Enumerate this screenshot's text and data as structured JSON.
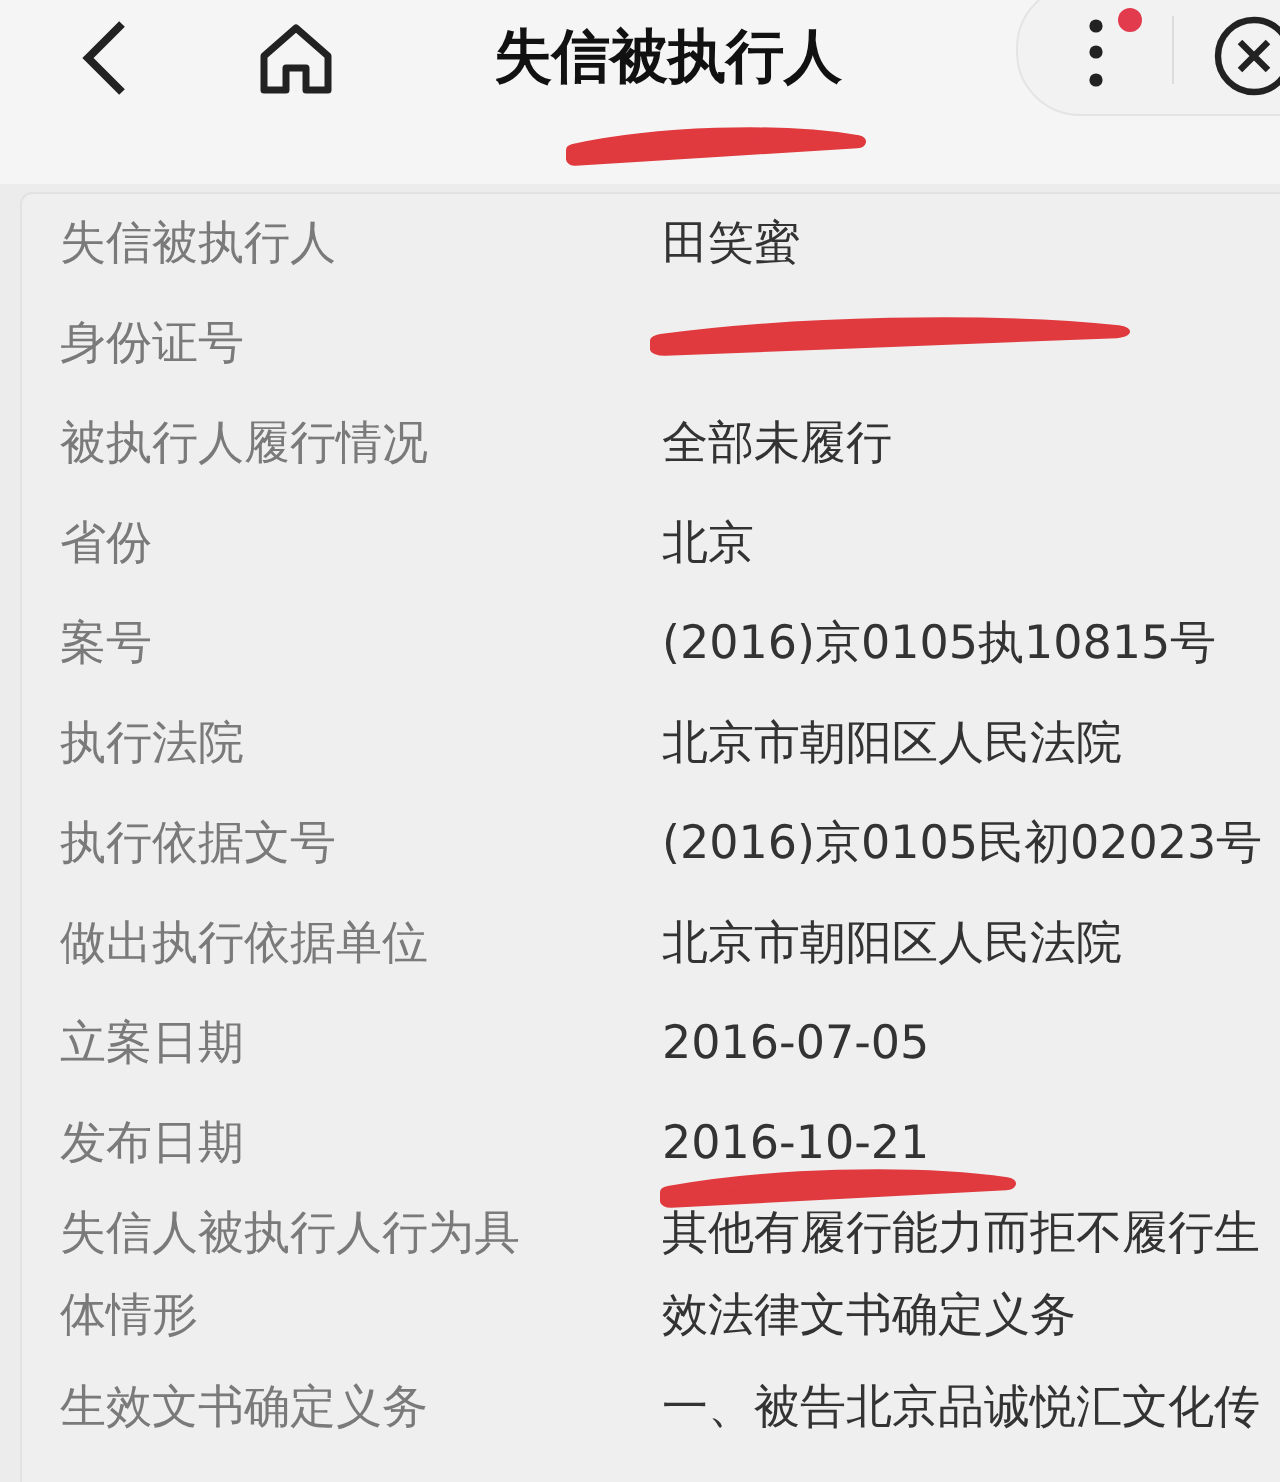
{
  "top_bar": {
    "title": "失信被执行人",
    "title_redacted": true,
    "menu_badge": true
  },
  "rows": [
    {
      "label": [
        "失信被执行人"
      ],
      "value": [
        "田笑蜜"
      ],
      "redacted": false
    },
    {
      "label": [
        "身份证号"
      ],
      "value": [],
      "redacted": true
    },
    {
      "label": [
        "被执行人履行情况"
      ],
      "value": [
        "全部未履行"
      ],
      "redacted": false
    },
    {
      "label": [
        "省份"
      ],
      "value": [
        "北京"
      ],
      "redacted": false
    },
    {
      "label": [
        "案号"
      ],
      "value": [
        "(2016)京0105执10815号"
      ],
      "redacted": false
    },
    {
      "label": [
        "执行法院"
      ],
      "value": [
        "北京市朝阳区人民法院"
      ],
      "redacted": false
    },
    {
      "label": [
        "执行依据文号"
      ],
      "value": [
        "(2016)京0105民初02023号"
      ],
      "redacted": false
    },
    {
      "label": [
        "做出执行依据单位"
      ],
      "value": [
        "北京市朝阳区人民法院"
      ],
      "redacted": false
    },
    {
      "label": [
        "立案日期"
      ],
      "value": [
        "2016-07-05"
      ],
      "redacted": false
    },
    {
      "label": [
        "发布日期"
      ],
      "value": [
        "2016-10-21"
      ],
      "redacted": true
    },
    {
      "label": [
        "失信人被执行人行为具",
        "体情形"
      ],
      "value": [
        "其他有履行能力而拒不履行生",
        "效法律文书确定义务"
      ],
      "redacted": false
    },
    {
      "label": [
        "生效文书确定义务"
      ],
      "value": [
        "一、被告北京品诚悦汇文化传"
      ],
      "redacted": false
    }
  ]
}
